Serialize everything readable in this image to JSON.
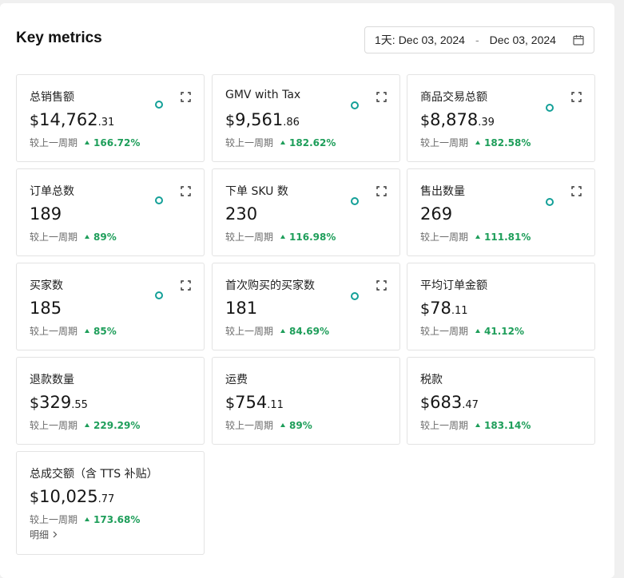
{
  "panel": {
    "title": "Key metrics",
    "date_range": {
      "prefix": "1天:",
      "start": "Dec 03, 2024",
      "separator": "-",
      "end": "Dec 03, 2024",
      "icon": "calendar-icon"
    }
  },
  "colors": {
    "up": "#1e9e5a",
    "dot": "#14a098",
    "border": "#e3e3e3"
  },
  "compare_label": "较上一周期",
  "cards": [
    {
      "title": "总销售额",
      "currency": "$",
      "int": "14,762",
      "dec": ".31",
      "change": "166.72%",
      "expand": true,
      "dot": true
    },
    {
      "title": "GMV with Tax",
      "currency": "$",
      "int": "9,561",
      "dec": ".86",
      "change": "182.62%",
      "expand": true,
      "dot": true
    },
    {
      "title": "商品交易总额",
      "currency": "$",
      "int": "8,878",
      "dec": ".39",
      "change": "182.58%",
      "expand": true,
      "dot": true
    },
    {
      "title": "订单总数",
      "currency": "",
      "int": "189",
      "dec": "",
      "change": "89%",
      "expand": true,
      "dot": true
    },
    {
      "title": "下单 SKU 数",
      "currency": "",
      "int": "230",
      "dec": "",
      "change": "116.98%",
      "expand": true,
      "dot": true
    },
    {
      "title": "售出数量",
      "currency": "",
      "int": "269",
      "dec": "",
      "change": "111.81%",
      "expand": true,
      "dot": true
    },
    {
      "title": "买家数",
      "currency": "",
      "int": "185",
      "dec": "",
      "change": "85%",
      "expand": true,
      "dot": true
    },
    {
      "title": "首次购买的买家数",
      "currency": "",
      "int": "181",
      "dec": "",
      "change": "84.69%",
      "expand": true,
      "dot": true
    },
    {
      "title": "平均订单金额",
      "currency": "$",
      "int": "78",
      "dec": ".11",
      "change": "41.12%",
      "expand": false,
      "dot": false
    },
    {
      "title": "退款数量",
      "currency": "$",
      "int": "329",
      "dec": ".55",
      "change": "229.29%",
      "expand": false,
      "dot": false
    },
    {
      "title": "运费",
      "currency": "$",
      "int": "754",
      "dec": ".11",
      "change": "89%",
      "expand": false,
      "dot": false
    },
    {
      "title": "税款",
      "currency": "$",
      "int": "683",
      "dec": ".47",
      "change": "183.14%",
      "expand": false,
      "dot": false
    },
    {
      "title": "总成交额（含 TTS 补贴）",
      "currency": "$",
      "int": "10,025",
      "dec": ".77",
      "change": "173.68%",
      "expand": false,
      "dot": false,
      "detail": "明细"
    }
  ]
}
